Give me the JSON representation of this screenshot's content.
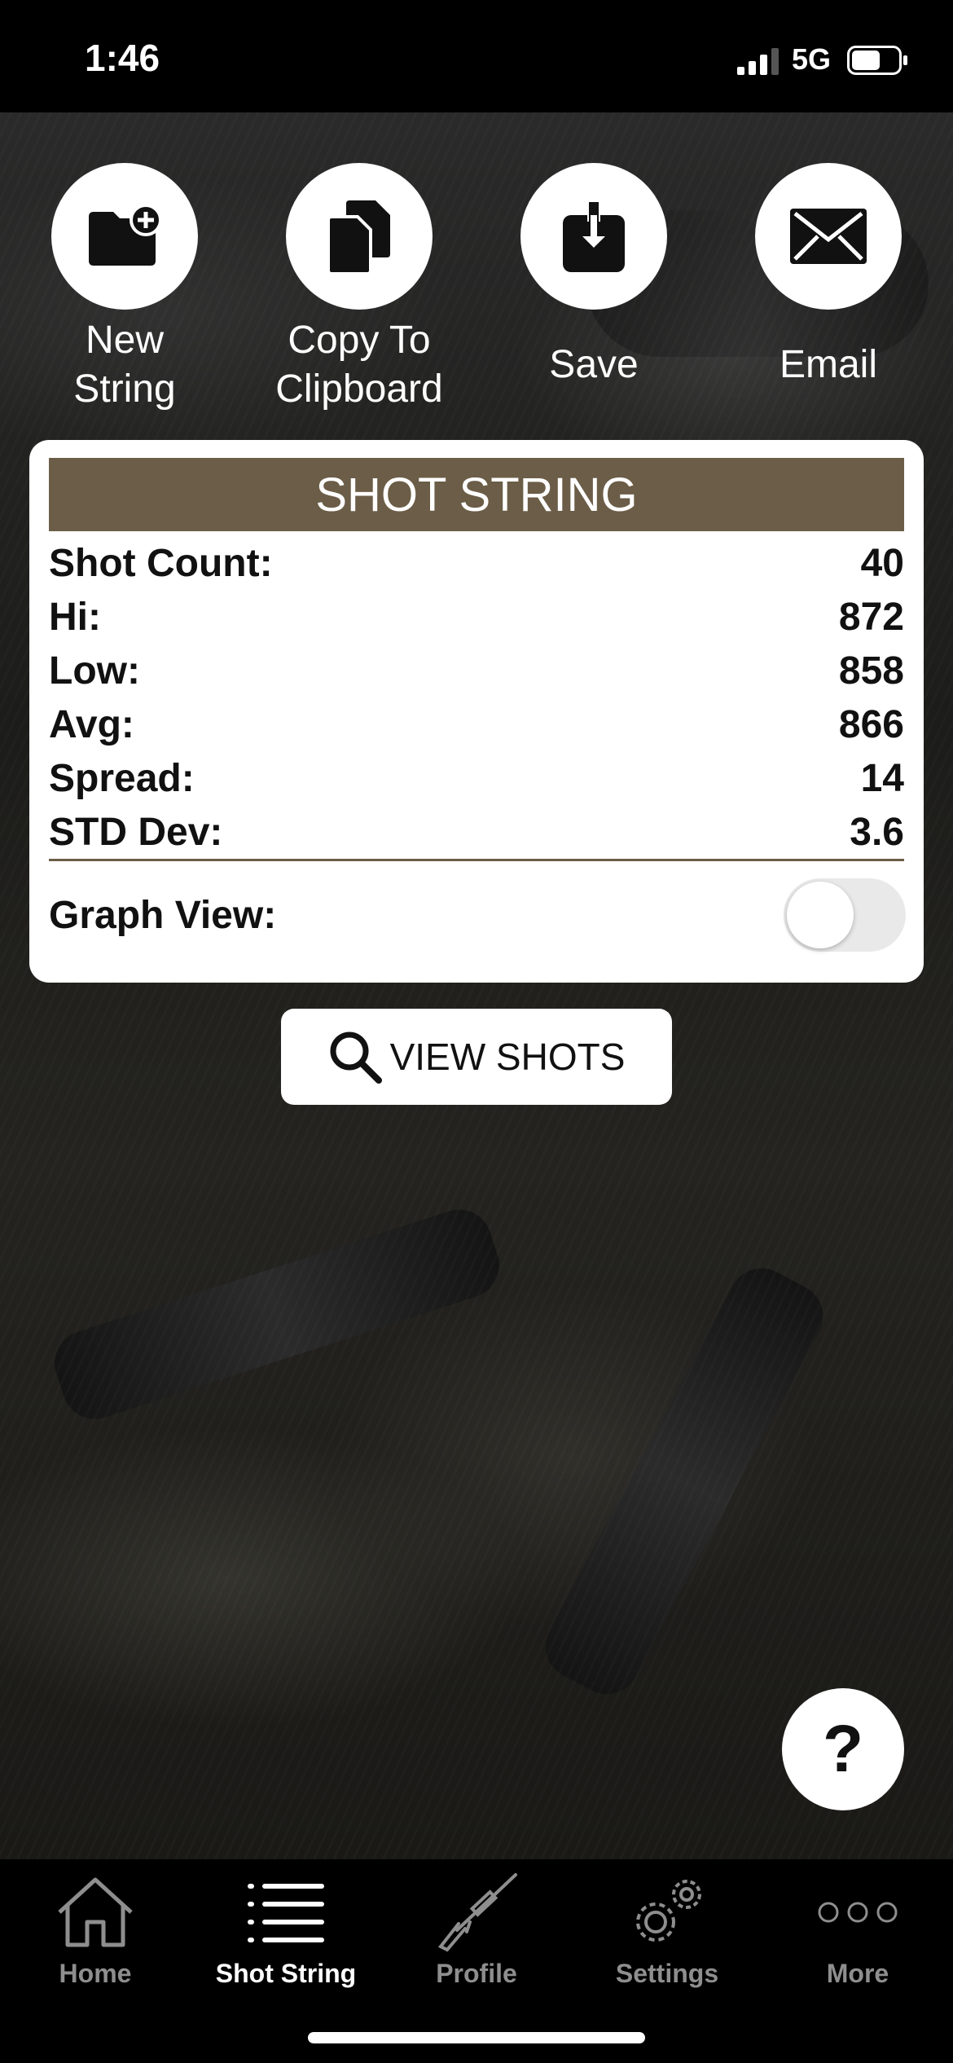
{
  "status_bar": {
    "time": "1:46",
    "network": "5G"
  },
  "actions": [
    {
      "label": "New\nString",
      "icon": "new-folder-icon"
    },
    {
      "label": "Copy To\nClipboard",
      "icon": "copy-icon"
    },
    {
      "label": "Save",
      "icon": "download-icon"
    },
    {
      "label": "Email",
      "icon": "envelope-icon"
    }
  ],
  "shot_string": {
    "title": "SHOT STRING",
    "stats": [
      {
        "label": "Shot Count:",
        "value": "40"
      },
      {
        "label": "Hi:",
        "value": "872"
      },
      {
        "label": "Low:",
        "value": "858"
      },
      {
        "label": "Avg:",
        "value": "866"
      },
      {
        "label": "Spread:",
        "value": "14"
      },
      {
        "label": "STD Dev:",
        "value": "3.6"
      }
    ],
    "graph_view_label": "Graph View:",
    "graph_view_enabled": false
  },
  "view_shots_label": "VIEW SHOTS",
  "help_label": "?",
  "tabs": [
    {
      "label": "Home",
      "icon": "home-icon",
      "active": false
    },
    {
      "label": "Shot String",
      "icon": "list-icon",
      "active": true
    },
    {
      "label": "Profile",
      "icon": "rifle-icon",
      "active": false
    },
    {
      "label": "Settings",
      "icon": "gears-icon",
      "active": false
    },
    {
      "label": "More",
      "icon": "ellipsis-icon",
      "active": false
    }
  ],
  "colors": {
    "accent": "#6b5d47",
    "background": "#000000",
    "card": "#ffffff",
    "tab_inactive": "#8e8e8e"
  }
}
